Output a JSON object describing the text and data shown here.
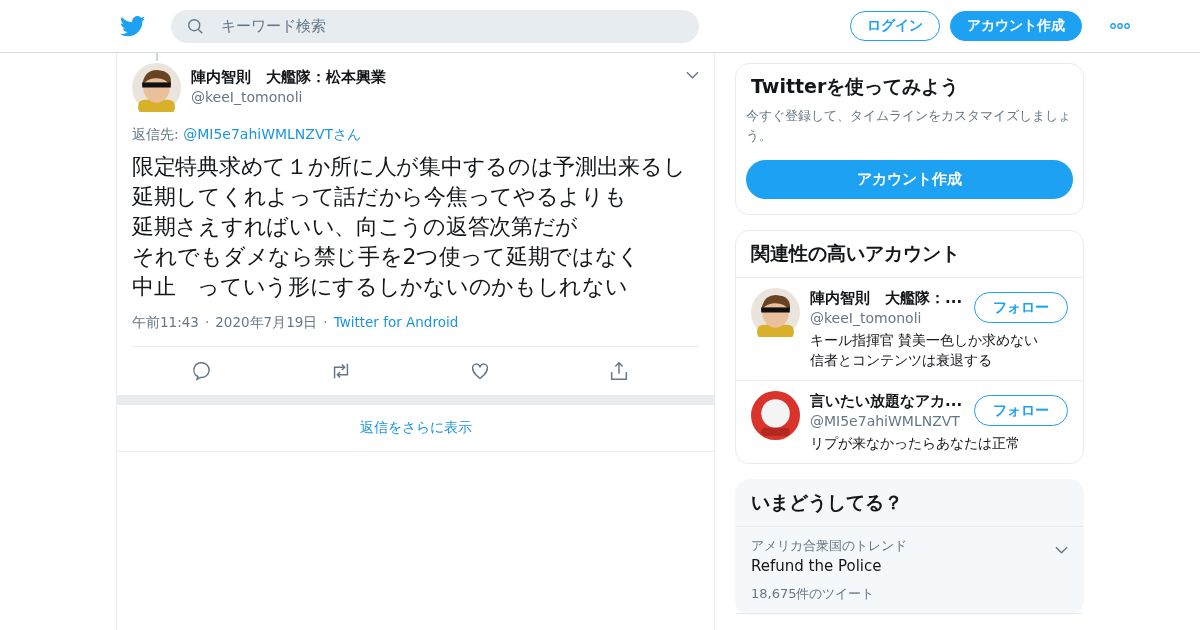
{
  "header": {
    "search": {
      "placeholder": "キーワード検索"
    },
    "login": "ログイン",
    "signup": "アカウント作成"
  },
  "tweet": {
    "name": "陣内智則　大艦隊：松本興業",
    "handle": "@keeI_tomonoli",
    "reply_prefix": "返信先: ",
    "reply_to": "@MI5e7ahiWMLNZVTさん",
    "lines": [
      "限定特典求めて１か所に人が集中するのは予測出来るし延期してくれよって話だから今焦ってやるよりも",
      "延期さえすればいい、向こうの返答次第だが",
      "それでもダメなら禁じ手を2つ使って延期ではなく",
      "中止　っていう形にするしかないのかもしれない"
    ],
    "time": "午前11:43",
    "separator": "·",
    "date": "2020年7月19日",
    "separator_2": "·",
    "source": "Twitter for Android"
  },
  "more_replies": "返信をさらに表示",
  "signup_card": {
    "title": "Twitterを使ってみよう",
    "text": "今すぐ登録して、タイムラインをカスタマイズしましょう。",
    "button": "アカウント作成"
  },
  "related": {
    "title": "関連性の高いアカウント",
    "accounts": [
      {
        "kind": "person",
        "name": "陣内智則　大艦隊：...",
        "handle": "@keeI_tomonoli",
        "bio": "キール指揮官 賛美一色しか求めない信者とコンテンツは衰退する",
        "button": "フォロー"
      },
      {
        "kind": "mask",
        "name": "言いたい放題なアカ...",
        "handle": "@MI5e7ahiWMLNZVT",
        "bio": "リプが来なかったらあなたは正常",
        "button": "フォロー"
      }
    ]
  },
  "trends": {
    "title": "いまどうしてる？",
    "items": [
      {
        "context": "アメリカ合衆国のトレンド",
        "name": "Refund the Police",
        "count": "18,675件のツイート"
      }
    ]
  }
}
